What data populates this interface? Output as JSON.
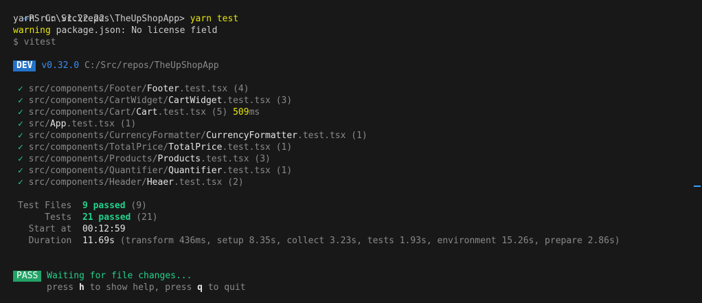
{
  "prompt": {
    "icon": "sync-prompt-icon",
    "text": "PS C:\\Src\\repos\\TheUpShopApp>",
    "command": "yarn test"
  },
  "header": {
    "yarn_run": "yarn run v1.22.22",
    "warning_label": "warning",
    "warning_text": " package.json: No license field",
    "cmd_line": "$ vitest"
  },
  "dev": {
    "badge": "DEV",
    "version": "v0.32.0",
    "path": "C:/Src/repos/TheUpShopApp"
  },
  "tests": [
    {
      "check": "✓",
      "dir": "src/components/Footer/",
      "name": "Footer",
      "ext": ".test.tsx",
      "count": " (4)",
      "time": "",
      "time_unit": ""
    },
    {
      "check": "✓",
      "dir": "src/components/CartWidget/",
      "name": "CartWidget",
      "ext": ".test.tsx",
      "count": " (3)",
      "time": "",
      "time_unit": ""
    },
    {
      "check": "✓",
      "dir": "src/components/Cart/",
      "name": "Cart",
      "ext": ".test.tsx",
      "count": " (5)",
      "time": "509",
      "time_unit": "ms"
    },
    {
      "check": "✓",
      "dir": "src/",
      "name": "App",
      "ext": ".test.tsx",
      "count": " (1)",
      "time": "",
      "time_unit": ""
    },
    {
      "check": "✓",
      "dir": "src/components/CurrencyFormatter/",
      "name": "CurrencyFormatter",
      "ext": ".test.tsx",
      "count": " (1)",
      "time": "",
      "time_unit": ""
    },
    {
      "check": "✓",
      "dir": "src/components/TotalPrice/",
      "name": "TotalPrice",
      "ext": ".test.tsx",
      "count": " (1)",
      "time": "",
      "time_unit": ""
    },
    {
      "check": "✓",
      "dir": "src/components/Products/",
      "name": "Products",
      "ext": ".test.tsx",
      "count": " (3)",
      "time": "",
      "time_unit": ""
    },
    {
      "check": "✓",
      "dir": "src/components/Quantifier/",
      "name": "Quantifier",
      "ext": ".test.tsx",
      "count": " (1)",
      "time": "",
      "time_unit": ""
    },
    {
      "check": "✓",
      "dir": "src/components/Header/",
      "name": "Heaer",
      "ext": ".test.tsx",
      "count": " (2)",
      "time": "",
      "time_unit": ""
    }
  ],
  "summary": {
    "test_files_label": "Test Files",
    "test_files_passed": "9 passed",
    "test_files_total": " (9)",
    "tests_label": "Tests",
    "tests_passed": "21 passed",
    "tests_total": " (21)",
    "start_label": "Start at",
    "start_value": "00:12:59",
    "duration_label": "Duration",
    "duration_value": "11.69s",
    "duration_detail": " (transform 436ms, setup 8.35s, collect 3.23s, tests 1.93s, environment 15.26s, prepare 2.86s)"
  },
  "footer": {
    "badge": "PASS",
    "waiting": "Waiting for file changes...",
    "help_pre": "press ",
    "help_key": "h",
    "help_mid": " to show help, press ",
    "quit_key": "q",
    "help_post": " to quit"
  },
  "colors": {
    "background": "#181818",
    "green": "#23d18b",
    "yellow": "#e5e510",
    "dev_badge": "#2472c8",
    "pass_badge": "#23a267"
  }
}
